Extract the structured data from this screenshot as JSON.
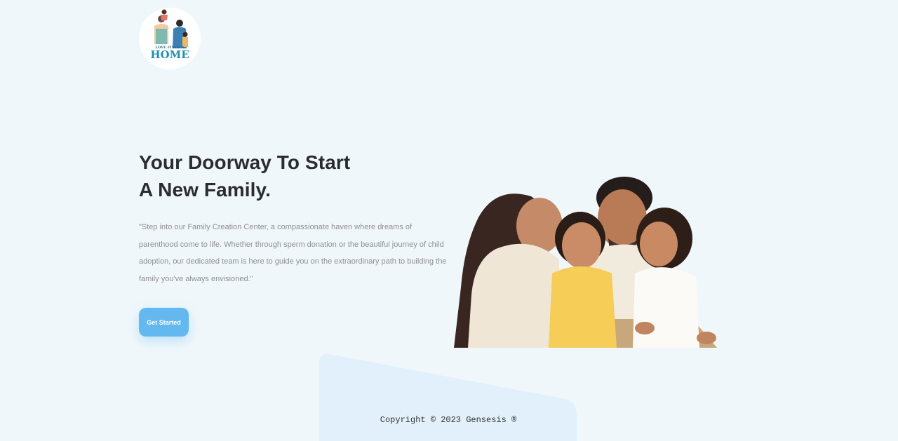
{
  "logo": {
    "text": "HOME",
    "tagline": "LOVE FINDS A",
    "icon": "family-logo-icon"
  },
  "hero": {
    "title_line1": "Your Doorway To Start",
    "title_line2": "A New Family.",
    "description": "\"Step into our Family Creation Center, a compassionate haven where dreams of parenthood come to life. Whether through sperm donation or the beautiful journey of child adoption, our dedicated team is here to guide you on the extraordinary path to building the family you've always envisioned.\"",
    "cta_label": "Get Started",
    "image": "family-photo"
  },
  "footer": {
    "copyright": "Copyright © 2023 Gensesis ®"
  },
  "colors": {
    "background": "#f0f7fb",
    "accent": "#62b8ef",
    "footer_shape": "#e1f0fa",
    "heading": "#2b2b33"
  }
}
